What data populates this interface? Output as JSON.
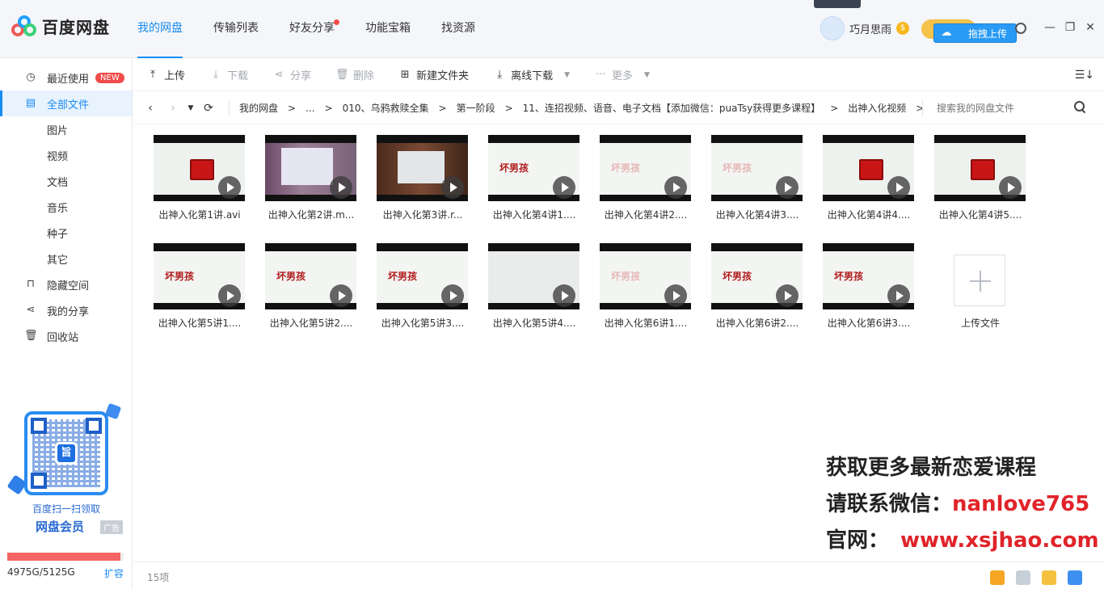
{
  "app": {
    "title": "百度网盘",
    "nav": [
      {
        "label": "我的网盘",
        "active": true
      },
      {
        "label": "传输列表"
      },
      {
        "label": "好友分享",
        "dot": true
      },
      {
        "label": "功能宝箱"
      },
      {
        "label": "找资源"
      }
    ],
    "user": {
      "name": "巧月思雨",
      "coin_symbol": "$"
    },
    "drag_upload": "拖拽上传",
    "window_controls": {
      "minimize": "—",
      "restore": "❐",
      "close": "✕"
    }
  },
  "sidebar": {
    "items": [
      {
        "label": "最近使用",
        "icon": "clock-icon",
        "glyph": "◷",
        "badge": "NEW"
      },
      {
        "label": "全部文件",
        "icon": "file-icon",
        "glyph": "▤",
        "active": true
      },
      {
        "label": "图片",
        "sub": true
      },
      {
        "label": "视频",
        "sub": true
      },
      {
        "label": "文档",
        "sub": true
      },
      {
        "label": "音乐",
        "sub": true
      },
      {
        "label": "种子",
        "sub": true
      },
      {
        "label": "其它",
        "sub": true
      },
      {
        "label": "隐藏空间",
        "icon": "lock-icon",
        "glyph": "⊓"
      },
      {
        "label": "我的分享",
        "icon": "share-icon",
        "glyph": "⋖"
      },
      {
        "label": "回收站",
        "icon": "trash-icon",
        "glyph": "🗑"
      }
    ],
    "promo": {
      "qr_center": "旨",
      "line1": "百度扫一扫领取",
      "line2": "网盘会员",
      "ad": "广告"
    },
    "storage": {
      "used_fraction": 0.971,
      "text": "4975G/5125G",
      "expand": "扩容"
    }
  },
  "toolbar": {
    "upload": "上传",
    "download": "下载",
    "share": "分享",
    "delete": "删除",
    "new_folder": "新建文件夹",
    "offline_download": "离线下载",
    "more": "更多"
  },
  "breadcrumb": {
    "items": [
      "我的网盘",
      "...",
      "010、乌鸦救赎全集",
      "第一阶段",
      "11、连招视频、语音、电子文档【添加微信：puaTsy获得更多课程】",
      "出神入化视频"
    ],
    "search_placeholder": "搜索我的网盘文件"
  },
  "files": [
    {
      "name": "出神入化第1讲.avi",
      "thumb": "red-logo"
    },
    {
      "name": "出神入化第2讲.m...",
      "thumb": "stage1"
    },
    {
      "name": "出神入化第3讲.r...",
      "thumb": "stage2"
    },
    {
      "name": "出神入化第4讲1....",
      "thumb": "title-card",
      "card_text": "坏男孩"
    },
    {
      "name": "出神入化第4讲2....",
      "thumb": "title-card-faint",
      "card_text": "坏男孩"
    },
    {
      "name": "出神入化第4讲3....",
      "thumb": "title-card-faint",
      "card_text": "坏男孩"
    },
    {
      "name": "出神入化第4讲4....",
      "thumb": "red-logo"
    },
    {
      "name": "出神入化第4讲5....",
      "thumb": "red-logo"
    },
    {
      "name": "出神入化第5讲1....",
      "thumb": "title-card",
      "card_text": "坏男孩"
    },
    {
      "name": "出神入化第5讲2....",
      "thumb": "title-card",
      "card_text": "坏男孩"
    },
    {
      "name": "出神入化第5讲3....",
      "thumb": "title-card",
      "card_text": "坏男孩"
    },
    {
      "name": "出神入化第5讲4....",
      "thumb": "blank"
    },
    {
      "name": "出神入化第6讲1....",
      "thumb": "title-card-faint",
      "card_text": "坏男孩"
    },
    {
      "name": "出神入化第6讲2....",
      "thumb": "title-card",
      "card_text": "坏男孩"
    },
    {
      "name": "出神入化第6讲3....",
      "thumb": "title-card",
      "card_text": "坏男孩"
    }
  ],
  "upload_tile_label": "上传文件",
  "watermark": {
    "line1": "获取更多最新恋爱课程",
    "line2_prefix": "请联系微信：",
    "line2_value": "nanlove765",
    "line3_prefix": "官网：",
    "line3_value": "www.xsjhao.com"
  },
  "footer": {
    "count": "15项"
  }
}
